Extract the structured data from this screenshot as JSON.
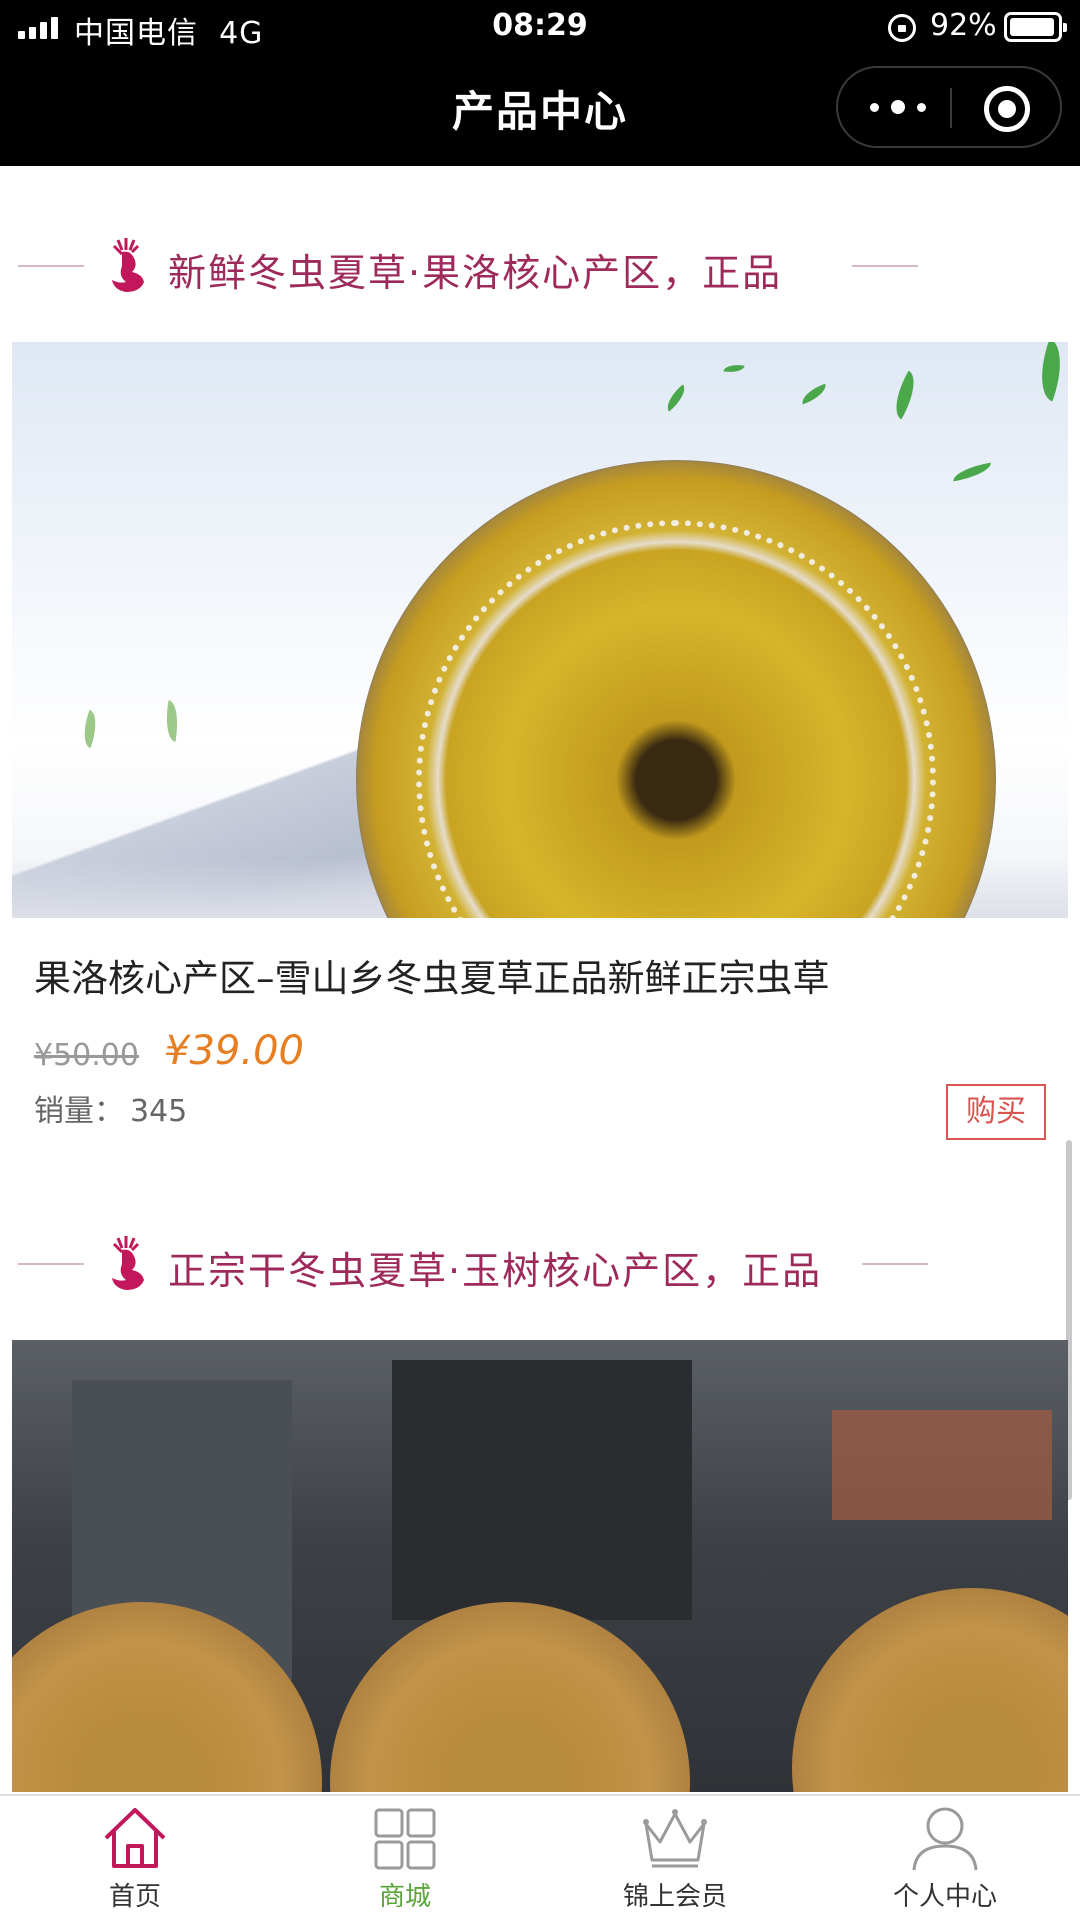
{
  "status_bar": {
    "carrier": "中国电信",
    "network": "4G",
    "time": "08:29",
    "battery": "92%"
  },
  "nav": {
    "title": "产品中心"
  },
  "sections": [
    {
      "heading": "新鲜冬虫夏草·果洛核心产区，正品",
      "product": {
        "title": "果洛核心产区–雪山乡冬虫夏草正品新鲜正宗虫草",
        "original_price": "¥50.00",
        "price": "¥39.00",
        "sales_label": "销量：",
        "sales_count": "345",
        "buy_label": "购买"
      }
    },
    {
      "heading": "正宗干冬虫夏草·玉树核心产区，正品"
    }
  ],
  "tabbar": {
    "items": [
      {
        "label": "首页",
        "icon": "home-icon"
      },
      {
        "label": "商城",
        "icon": "grid-icon",
        "active": true
      },
      {
        "label": "锦上会员",
        "icon": "crown-icon"
      },
      {
        "label": "个人中心",
        "icon": "person-icon"
      }
    ]
  },
  "colors": {
    "heading": "#9e2a5c",
    "price": "#e67e22",
    "buy_button": "#d9534f",
    "active_tab": "#5aa63b"
  }
}
